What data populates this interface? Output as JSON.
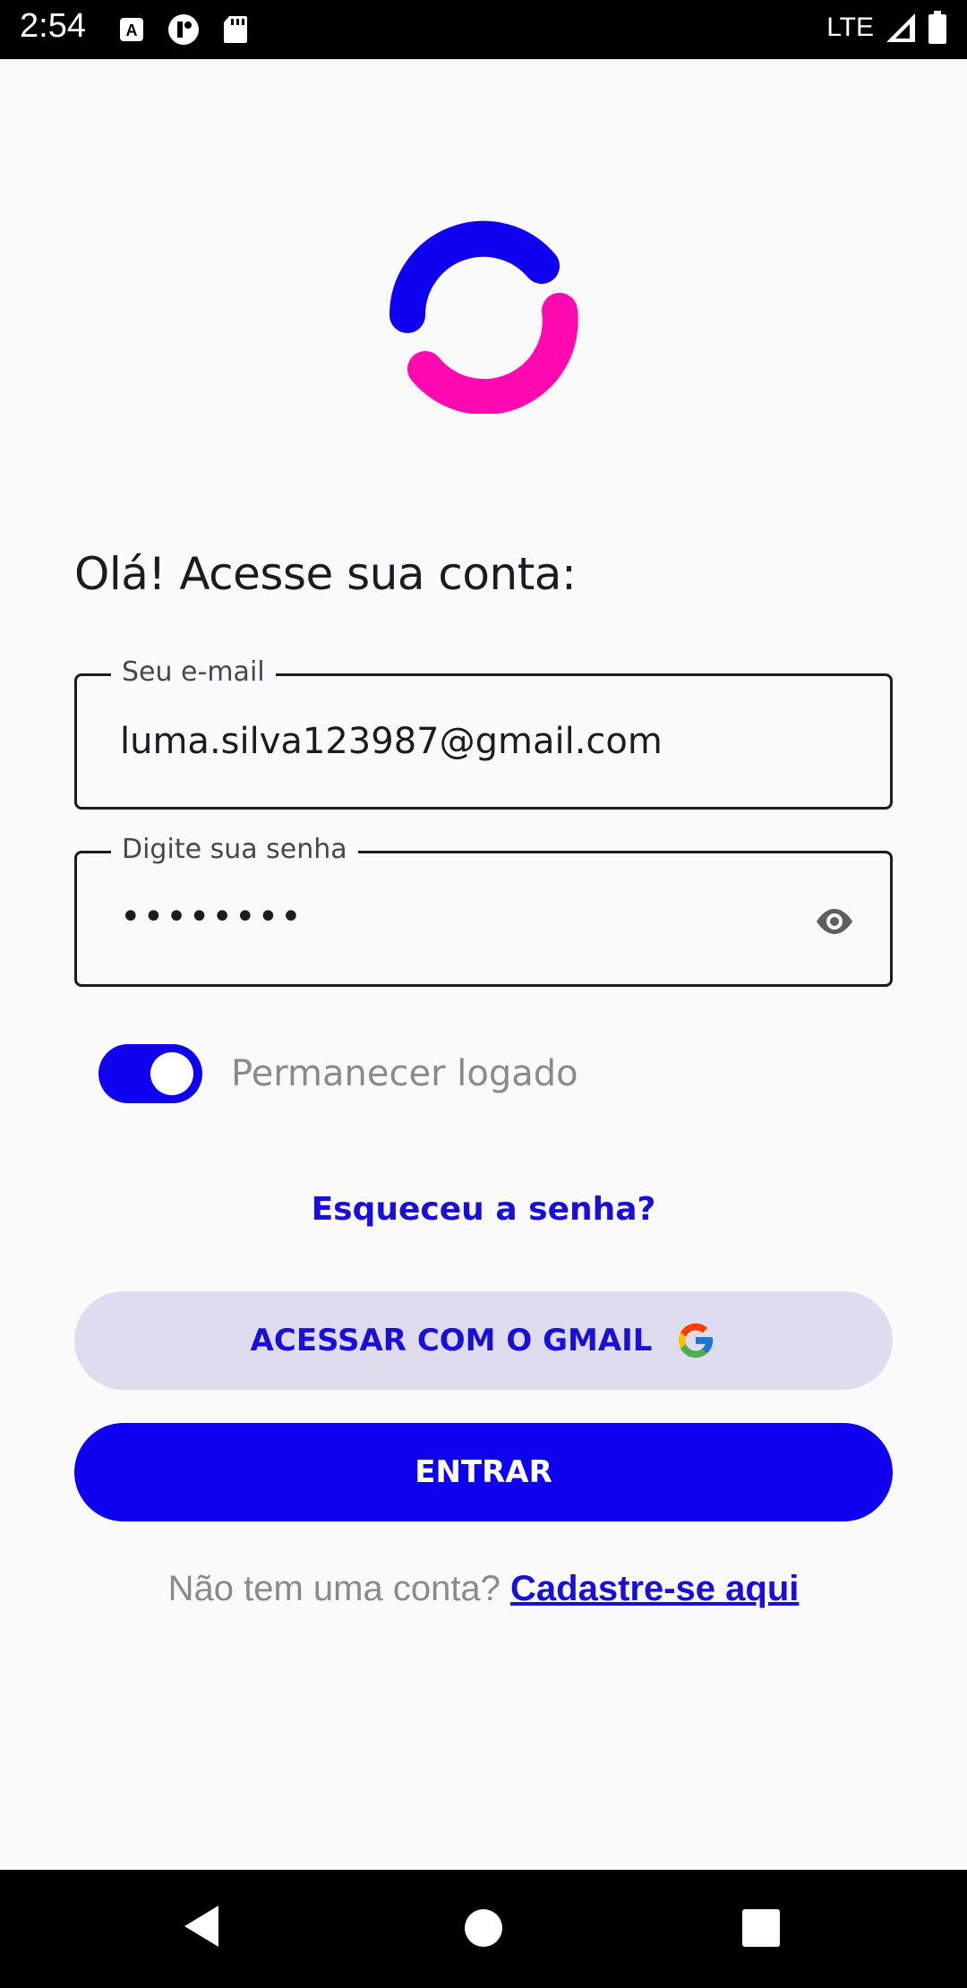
{
  "status_bar": {
    "time": "2:54",
    "network": "LTE",
    "icons": [
      "a-icon",
      "vpn-icon",
      "sd-card-icon",
      "signal-icon",
      "battery-icon"
    ]
  },
  "logo": {
    "name": "app-logo",
    "colors": [
      "#1000f0",
      "#ff0ab0"
    ]
  },
  "heading": "Olá! Acesse sua conta:",
  "email_field": {
    "label": "Seu e-mail",
    "value": "luma.silva123987@gmail.com"
  },
  "password_field": {
    "label": "Digite sua senha",
    "value": "••••••••",
    "icon": "eye-icon"
  },
  "remember": {
    "label": "Permanecer logado",
    "checked": true
  },
  "forgot_link": "Esqueceu a senha?",
  "gmail_button": {
    "label": "ACESSAR COM O GMAIL",
    "icon": "google-icon"
  },
  "enter_button": {
    "label": "ENTRAR"
  },
  "signup": {
    "prompt": "Não tem uma conta?",
    "link": "Cadastre-se aqui"
  },
  "colors": {
    "accent": "#1000f0",
    "accent_light": "#dfdcf0",
    "pink": "#ff0ab0"
  },
  "nav_bar": {
    "icons": [
      "back-icon",
      "home-icon",
      "recents-icon"
    ]
  }
}
